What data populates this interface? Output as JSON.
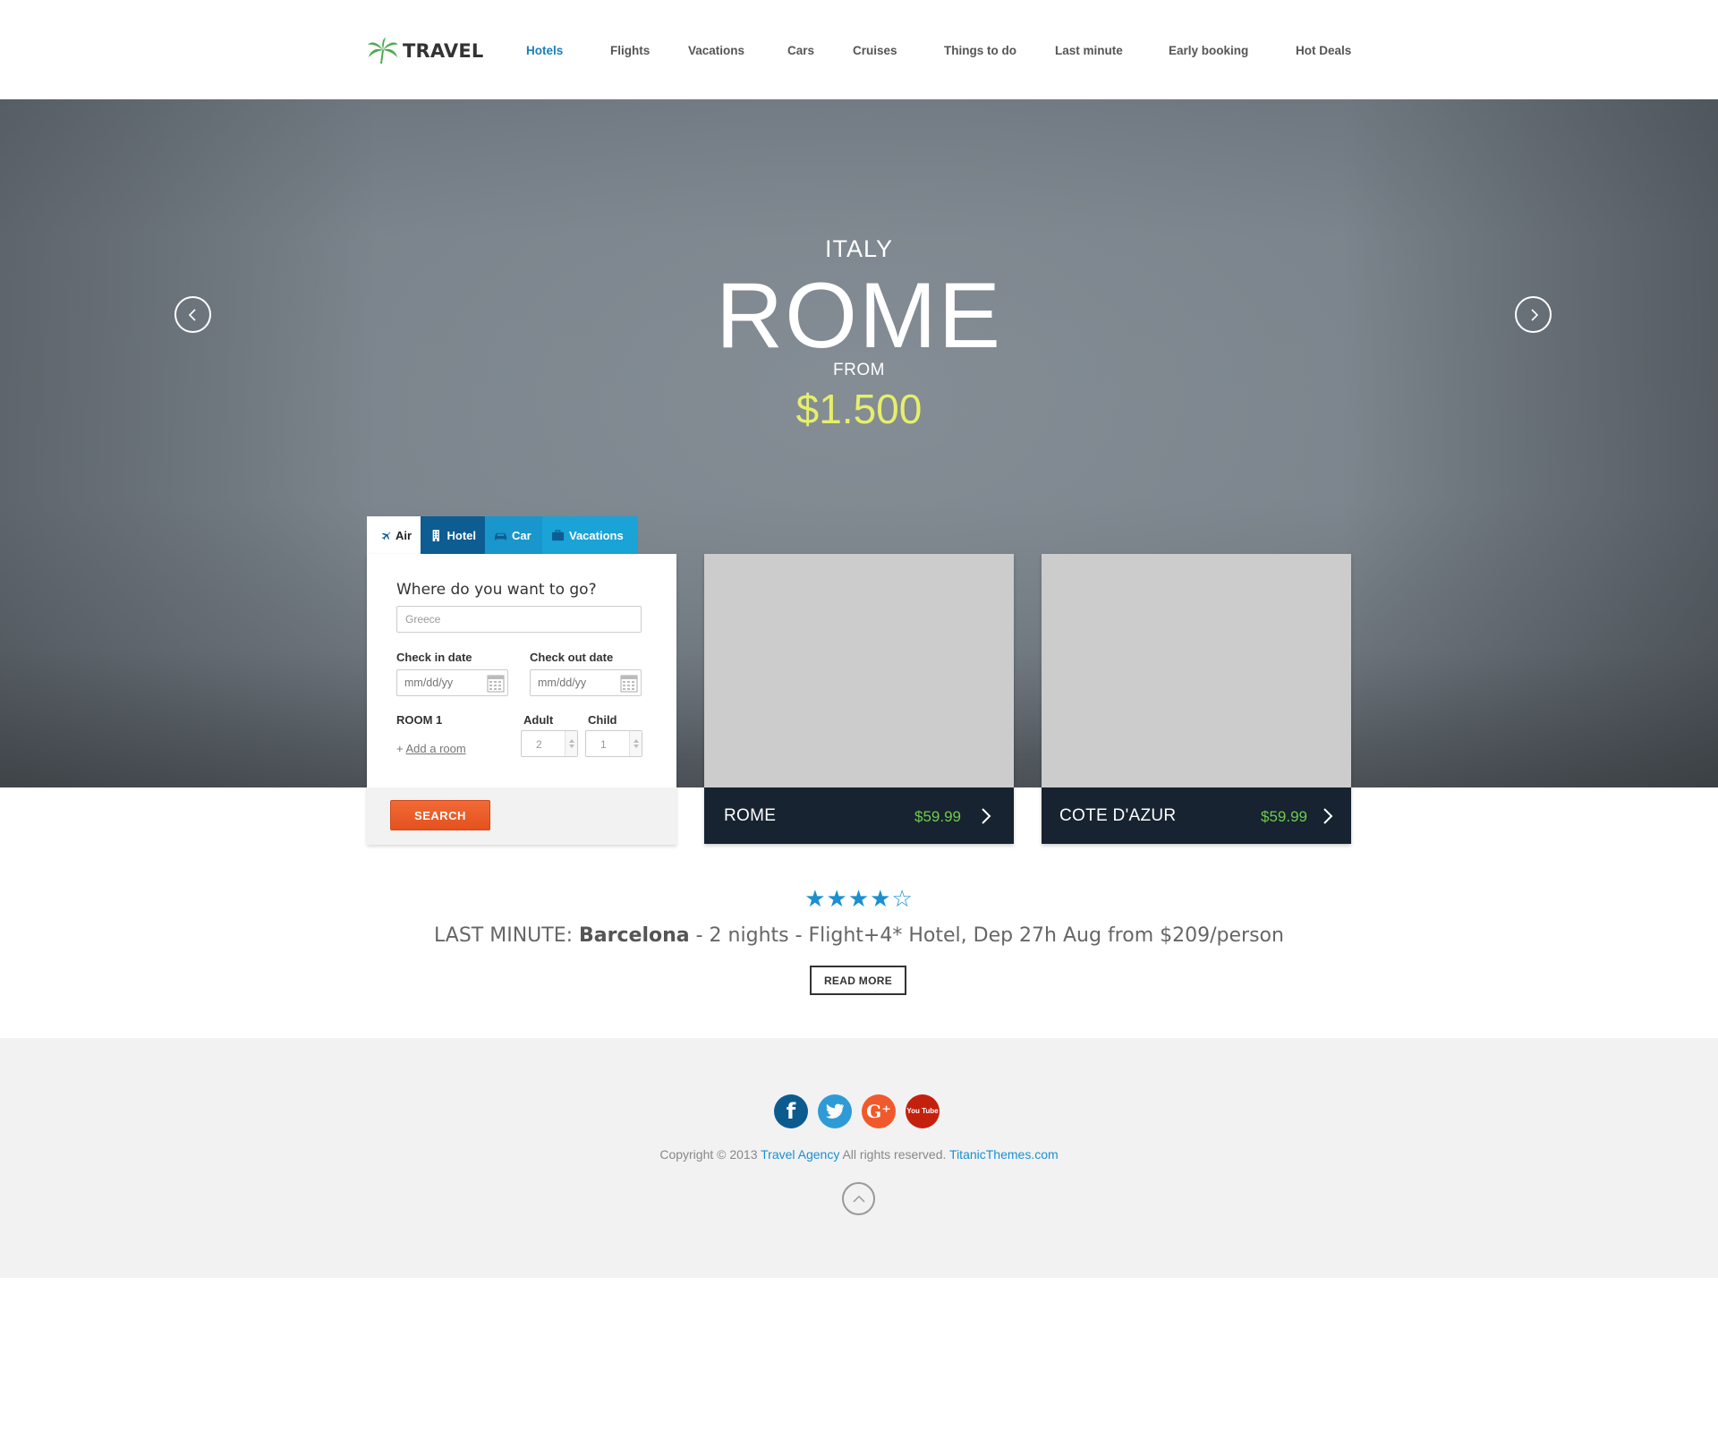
{
  "header": {
    "logo_text": "TRAVEL",
    "nav": [
      {
        "label": "Hotels",
        "active": true
      },
      {
        "label": "Flights"
      },
      {
        "label": "Vacations"
      },
      {
        "label": "Cars"
      },
      {
        "label": "Cruises"
      },
      {
        "label": "Things to do"
      },
      {
        "label": "Last minute"
      },
      {
        "label": "Early booking"
      },
      {
        "label": "Hot Deals"
      }
    ]
  },
  "hero": {
    "country": "ITALY",
    "city": "ROME",
    "from_label": "FROM",
    "price": "$1.500",
    "prev_icon": "chevron-left-icon",
    "next_icon": "chevron-right-icon"
  },
  "search": {
    "tabs": [
      {
        "label": "Air",
        "icon": "plane-icon"
      },
      {
        "label": "Hotel",
        "icon": "building-icon"
      },
      {
        "label": "Car",
        "icon": "car-icon"
      },
      {
        "label": "Vacations",
        "icon": "suitcase-icon"
      }
    ],
    "question": "Where do you want to go?",
    "destination_value": "Greece",
    "check_in_label": "Check in date",
    "check_out_label": "Check out date",
    "date_placeholder": "mm/dd/yy",
    "room_label": "ROOM 1",
    "adult_label": "Adult",
    "child_label": "Child",
    "adult_value": "2",
    "child_value": "1",
    "add_room_prefix": "+",
    "add_room_label": "Add a room",
    "search_button": "SEARCH"
  },
  "deals": [
    {
      "name": "ROME",
      "price": "$59.99"
    },
    {
      "name": "COTE D'AZUR",
      "price": "$59.99"
    }
  ],
  "last_minute": {
    "rating": 4,
    "rating_max": 5,
    "prefix": "LAST MINUTE:",
    "destination": "Barcelona",
    "details": "- 2 nights - Flight+4* Hotel, Dep 27h Aug from $209/person",
    "read_more": "READ MORE"
  },
  "footer": {
    "social": [
      {
        "name": "facebook",
        "label": "f"
      },
      {
        "name": "twitter",
        "label": ""
      },
      {
        "name": "google-plus",
        "label": "G⁺"
      },
      {
        "name": "youtube",
        "label": "You Tube"
      }
    ],
    "copyright_prefix": "Copyright © 2013",
    "agency_link": "Travel Agency",
    "rights": "All rights reserved.",
    "theme_link": "TitanicThemes.com"
  },
  "colors": {
    "accent": "#1a7fba",
    "search_button": "#f26a37",
    "price_highlight": "#e6ef6a",
    "deal_price": "#6ecb4e",
    "deal_bar": "#172330"
  }
}
